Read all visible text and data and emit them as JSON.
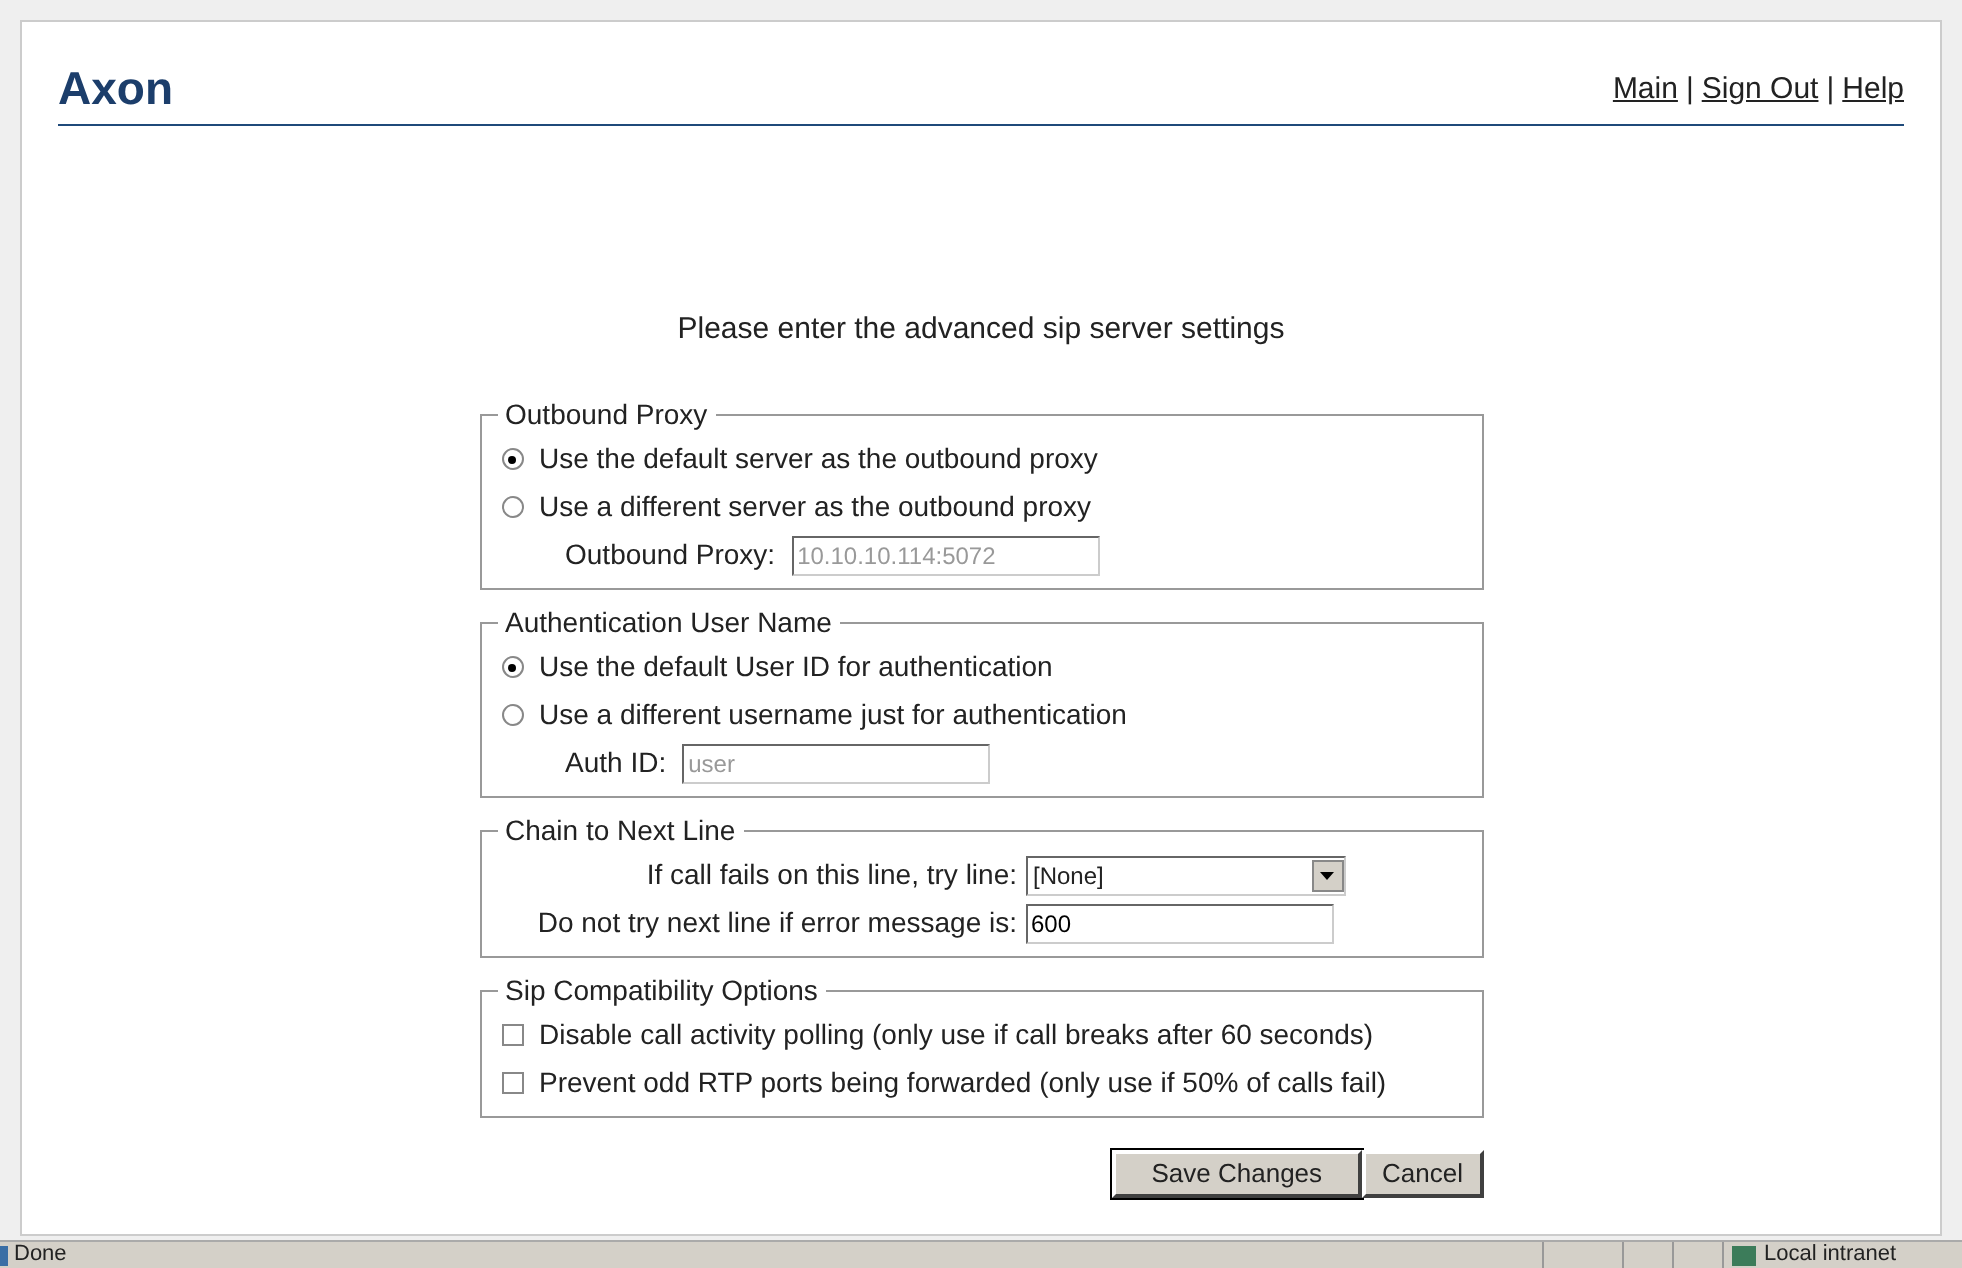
{
  "header": {
    "title": "Axon",
    "links": [
      "Main",
      "Sign Out",
      "Help"
    ],
    "separators": [
      "|",
      "|"
    ]
  },
  "instructions": "Please enter the advanced sip server settings",
  "sections": [
    {
      "legend": "Outbound Proxy",
      "items": [
        {
          "kind": "radio",
          "label": "Use the default server as the outbound proxy",
          "selected": true
        },
        {
          "kind": "radio",
          "label": "Use a different server as the outbound proxy",
          "selected": false
        },
        {
          "kind": "field",
          "label": "Outbound Proxy:",
          "value": "10.10.10.114:5072",
          "disabled": true
        }
      ]
    },
    {
      "legend": "Authentication User Name",
      "items": [
        {
          "kind": "radio",
          "label": "Use the default User ID for authentication",
          "selected": true
        },
        {
          "kind": "radio",
          "label": "Use a different username just for authentication",
          "selected": false
        },
        {
          "kind": "field",
          "label": "Auth ID:",
          "value": "user",
          "disabled": true
        }
      ]
    },
    {
      "legend": "Chain to Next Line",
      "items": [
        {
          "kind": "select",
          "label": "If call fails on this line, try line:",
          "value": "[None]"
        },
        {
          "kind": "field",
          "label": "Do not try next line if error message is:",
          "value": "600",
          "disabled": false
        }
      ]
    },
    {
      "legend": "Sip Compatibility Options",
      "items": [
        {
          "kind": "checkbox",
          "label": "Disable call activity polling (only use if call breaks after 60 seconds)",
          "checked": false
        },
        {
          "kind": "checkbox",
          "label": "Prevent odd RTP ports being forwarded (only use if 50% of calls fail)",
          "checked": false
        }
      ]
    }
  ],
  "buttons": [
    "Save Changes",
    "Cancel"
  ],
  "status_bar": {
    "status": "Done",
    "zone": "Local intranet"
  }
}
